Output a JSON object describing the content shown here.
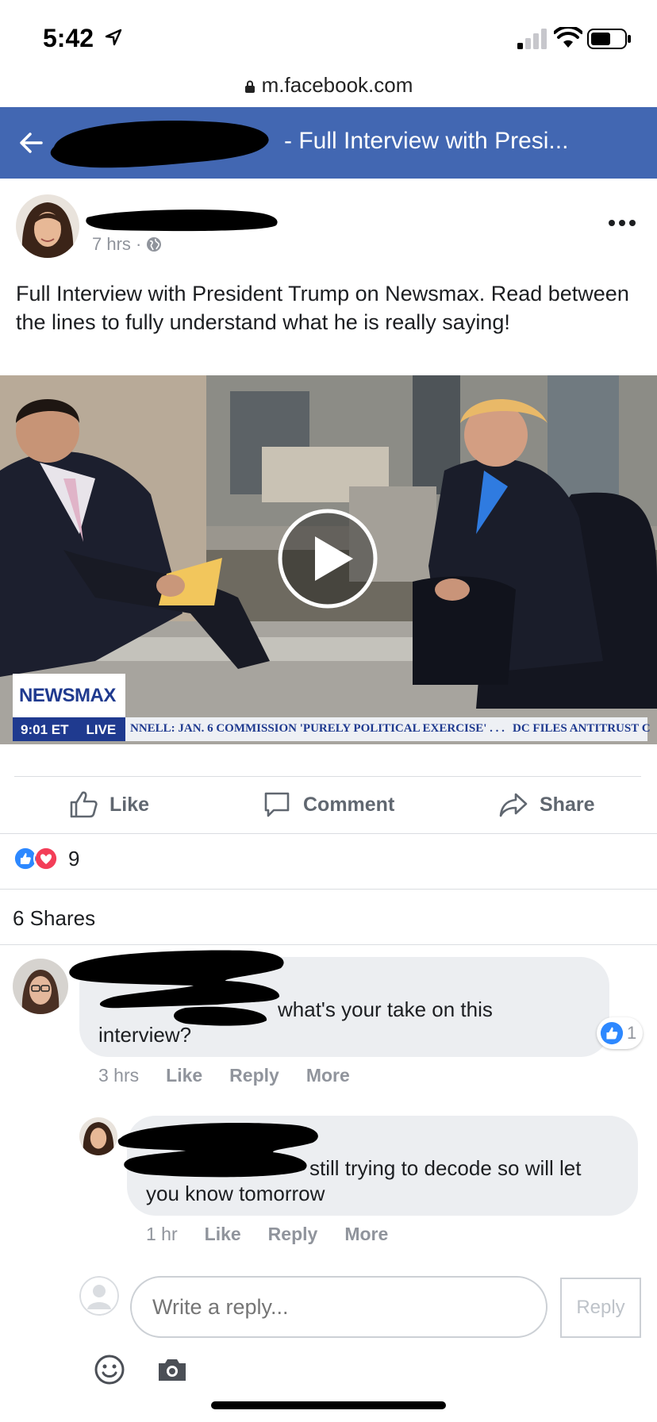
{
  "status_bar": {
    "time": "5:42"
  },
  "browser": {
    "url": "m.facebook.com"
  },
  "header": {
    "title": "- Full Interview with Presi..."
  },
  "post": {
    "time": "7 hrs ·",
    "text": "Full Interview with President Trump on Newsmax. Read between the lines to fully understand what he is really saying!",
    "video": {
      "logo": "NEWSMAX",
      "clock": "9:01 ET",
      "live": "LIVE",
      "ticker": "NNELL: JAN. 6 COMMISSION 'PURELY POLITICAL EXERCISE' . . .",
      "ticker2": "DC FILES ANTITRUST C"
    },
    "actions": {
      "like": "Like",
      "comment": "Comment",
      "share": "Share"
    },
    "reaction_count": "9",
    "shares_text": "6 Shares"
  },
  "comments": [
    {
      "text_line1": "what's your take on this",
      "text_line2": "interview?",
      "likes": "1",
      "time": "3 hrs",
      "like": "Like",
      "reply": "Reply",
      "more": "More"
    },
    {
      "text_line1": "still trying to decode so will let",
      "text_line2": "you know tomorrow",
      "time": "1 hr",
      "like": "Like",
      "reply": "Reply",
      "more": "More"
    }
  ],
  "reply_box": {
    "placeholder": "Write a reply...",
    "button": "Reply"
  },
  "colors": {
    "facebook_blue": "#4267b2",
    "meta_gray": "#90949c",
    "bubble": "#eceef1",
    "redaction": "#000000"
  },
  "icons": [
    "location-arrow-icon",
    "signal-icon",
    "wifi-icon",
    "battery-icon",
    "lock-icon",
    "back-arrow-icon",
    "globe-icon",
    "more-dots-icon",
    "play-icon",
    "like-icon",
    "comment-icon",
    "share-icon",
    "emoji-icon",
    "camera-icon"
  ]
}
